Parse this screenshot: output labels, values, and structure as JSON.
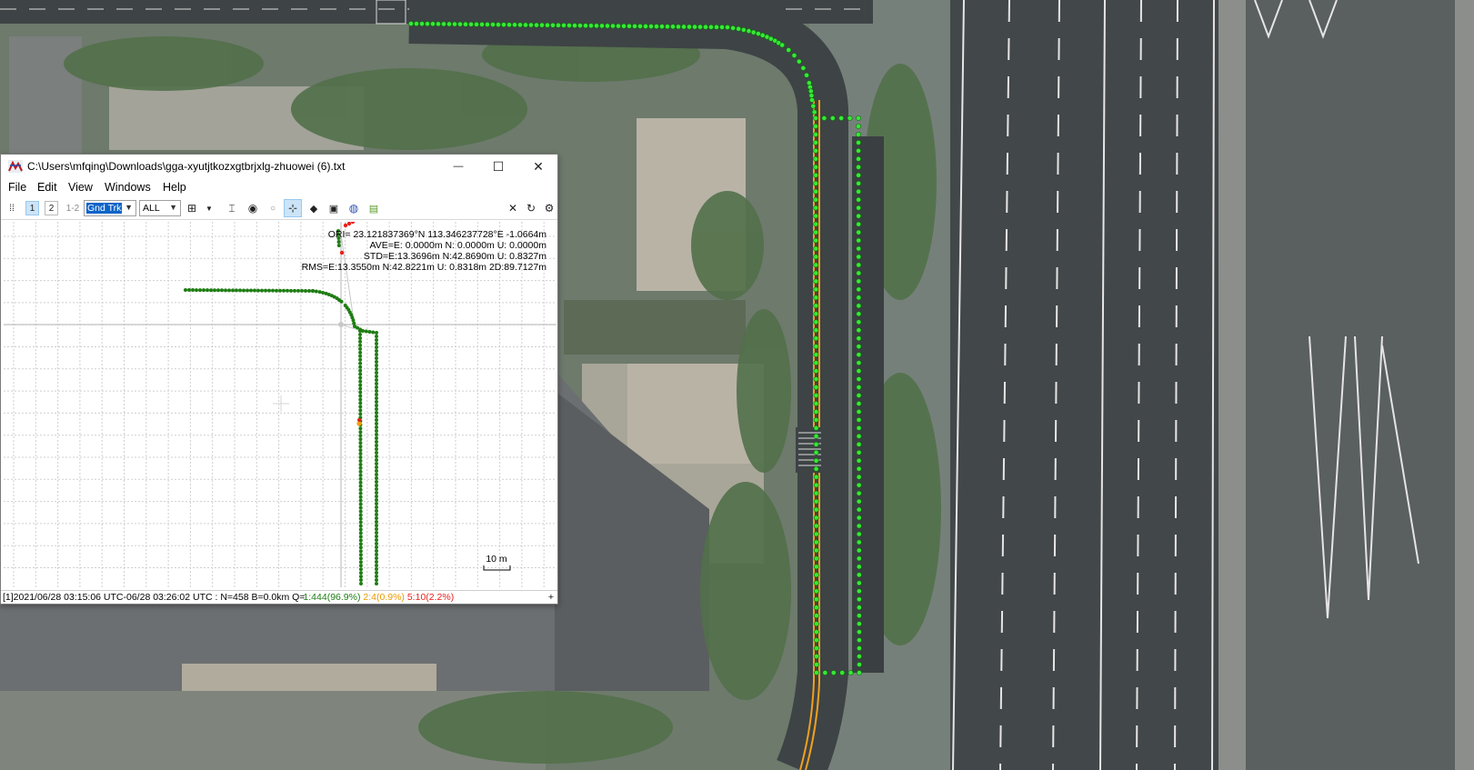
{
  "window": {
    "title": "C:\\Users\\mfqing\\Downloads\\gga-xyutjtkozxgtbrjxlg-zhuowei (6).txt",
    "minimize_glyph": "—",
    "maximize_glyph": "☐",
    "close_glyph": "✕"
  },
  "menu": [
    "File",
    "Edit",
    "View",
    "Windows",
    "Help"
  ],
  "toolbar": {
    "plot1": "1",
    "plot2": "2",
    "plot12": "1-2",
    "plot_type": "Gnd Trk",
    "sat_filter": "ALL",
    "icons": [
      "split-icon",
      "ns-icon",
      "center-icon",
      "circle-icon",
      "grid-icon",
      "point-icon",
      "map-icon",
      "globe-icon",
      "image-icon",
      "close-icon",
      "reload-icon",
      "settings-icon"
    ]
  },
  "plot": {
    "ori": "ORI= 23.121837369°N  113.346237728°E -1.0664m",
    "ave": "AVE=E: 0.0000m N: 0.0000m U: 0.0000m",
    "std": "STD=E:13.3696m N:42.8690m U: 0.8327m",
    "rms": "RMS=E:13.3550m N:42.8221m U: 0.8318m 2D:89.7127m",
    "scale": "10 m"
  },
  "status": {
    "range": "[1]2021/06/28 03:15:06 UTC-06/28 03:26:02 UTC : N=458 B=0.0km Q=",
    "q1": "1:444(96.9%)",
    "q2": "2:4(0.9%)",
    "q5": "5:10(2.2%)",
    "plus": "+"
  },
  "colors": {
    "fix": "#1e7d13",
    "float": "#f0a000",
    "single": "#e8201a",
    "map_track": "#36e836",
    "road": "#3d4244"
  }
}
